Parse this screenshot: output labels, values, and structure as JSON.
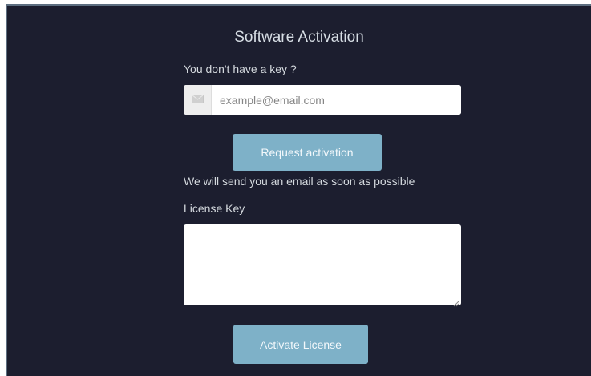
{
  "window": {
    "title": "Software Activation"
  },
  "request_section": {
    "no_key_label": "You don't have a key ?",
    "email_placeholder": "example@email.com",
    "email_value": "",
    "email_icon": "envelope-icon",
    "request_button_label": "Request activation",
    "notice_text": "We will send you an email as soon as possible"
  },
  "license_section": {
    "license_label": "License Key",
    "license_value": "",
    "activate_button_label": "Activate License"
  },
  "colors": {
    "background": "#1c1e2f",
    "button": "#7eb1c8",
    "text": "#d4d9de"
  }
}
